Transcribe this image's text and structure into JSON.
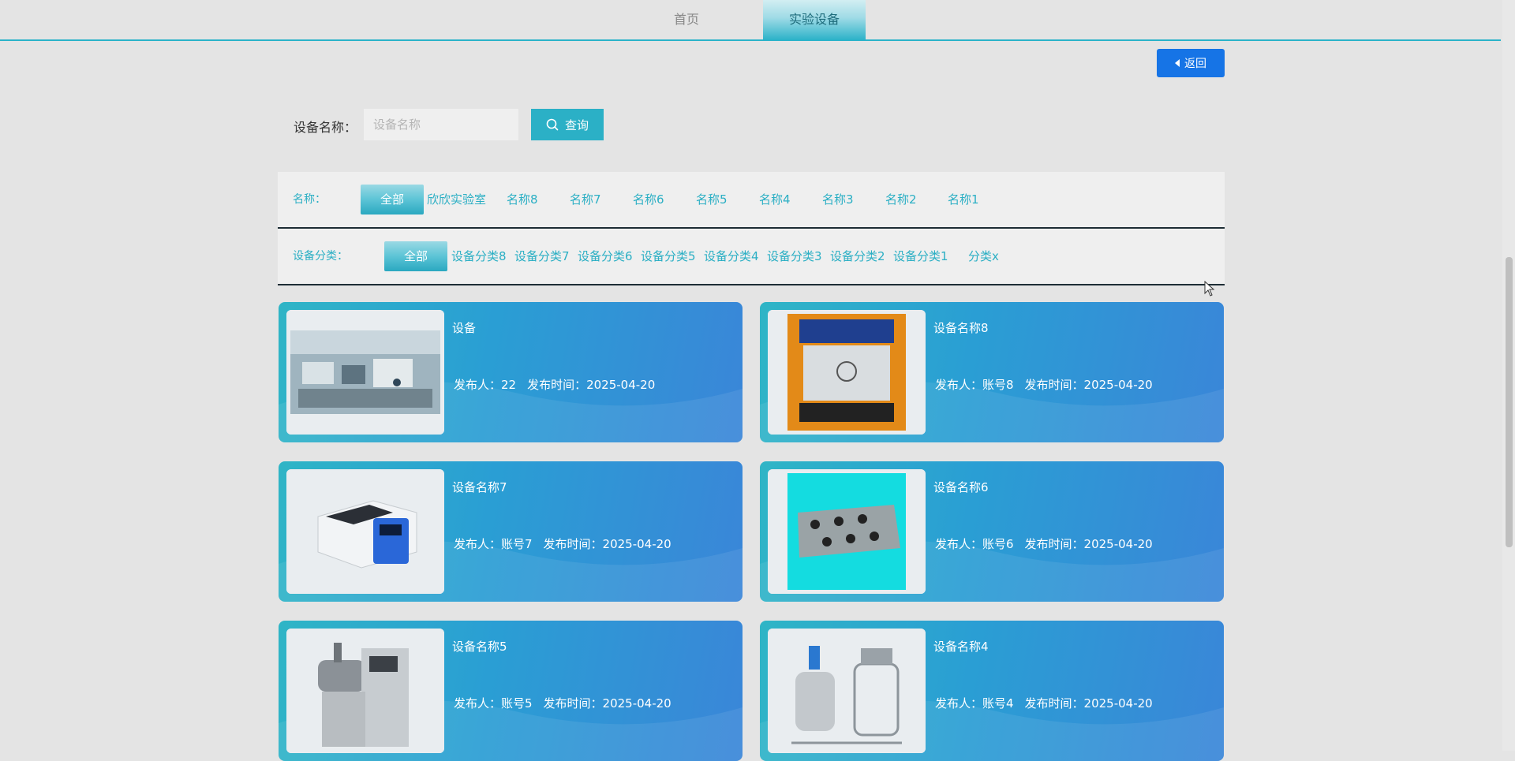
{
  "nav": {
    "home": "首页",
    "equipment": "实验设备"
  },
  "back_label": "返回",
  "search": {
    "label": "设备名称：",
    "placeholder": "设备名称",
    "button": "查询"
  },
  "filters": {
    "name": {
      "label": "名称：",
      "items": [
        "全部",
        "欣欣实验室",
        "名称8",
        "名称7",
        "名称6",
        "名称5",
        "名称4",
        "名称3",
        "名称2",
        "名称1"
      ],
      "active": "全部"
    },
    "category": {
      "label": "设备分类：",
      "items": [
        "全部",
        "设备分类8",
        "设备分类7",
        "设备分类6",
        "设备分类5",
        "设备分类4",
        "设备分类3",
        "设备分类2",
        "设备分类1",
        "分类x"
      ],
      "active": "全部"
    }
  },
  "cards": [
    {
      "title": "设备",
      "publisher": "发布人：22",
      "time": "发布时间：2025-04-20",
      "image": "lab-room-photo"
    },
    {
      "title": "设备名称8",
      "publisher": "发布人：账号8",
      "time": "发布时间：2025-04-20",
      "image": "tester-box-photo"
    },
    {
      "title": "设备名称7",
      "publisher": "发布人：账号7",
      "time": "发布时间：2025-04-20",
      "image": "heating-block-photo"
    },
    {
      "title": "设备名称6",
      "publisher": "发布人：账号6",
      "time": "发布时间：2025-04-20",
      "image": "resistance-box-photo"
    },
    {
      "title": "设备名称5",
      "publisher": "发布人：账号5",
      "time": "发布时间：2025-04-20",
      "image": "bead-mill-photo"
    },
    {
      "title": "设备名称4",
      "publisher": "发布人：账号4",
      "time": "发布时间：2025-04-20",
      "image": "reactor-tank-photo"
    }
  ],
  "colors": {
    "accent": "#2bb0c6",
    "primary_button": "#1674e6",
    "card_start": "#2fb5c6",
    "card_end": "#3a86d8"
  }
}
